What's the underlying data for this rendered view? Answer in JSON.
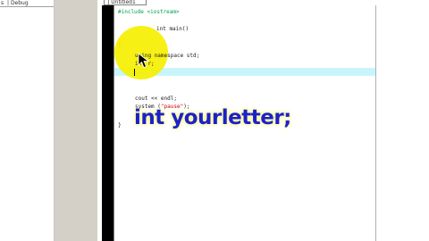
{
  "left_panel": {
    "tabs": [
      "s",
      "Debug"
    ]
  },
  "editor_tab": {
    "label": "] Untitled1"
  },
  "code": {
    "line1": "#include <iostream>",
    "line2": "int main()",
    "line3": "{",
    "line4": "using namespace std;",
    "line5": "int r;",
    "line6": "|",
    "line7": "cout << endl;",
    "line8_a": "system (",
    "line8_str": "\"pause\"",
    "line8_b": ");",
    "line9": "}"
  },
  "overlay": {
    "text": "int yourletter;"
  },
  "colors": {
    "gutter": "#000000",
    "current_line": "#c8f5fb",
    "highlight": "#f6ef00",
    "overlay_text": "#1c21c8",
    "preprocessor": "#00a04a",
    "string": "#d00000"
  },
  "icons": {
    "cursor": "mouse-pointer-icon"
  }
}
